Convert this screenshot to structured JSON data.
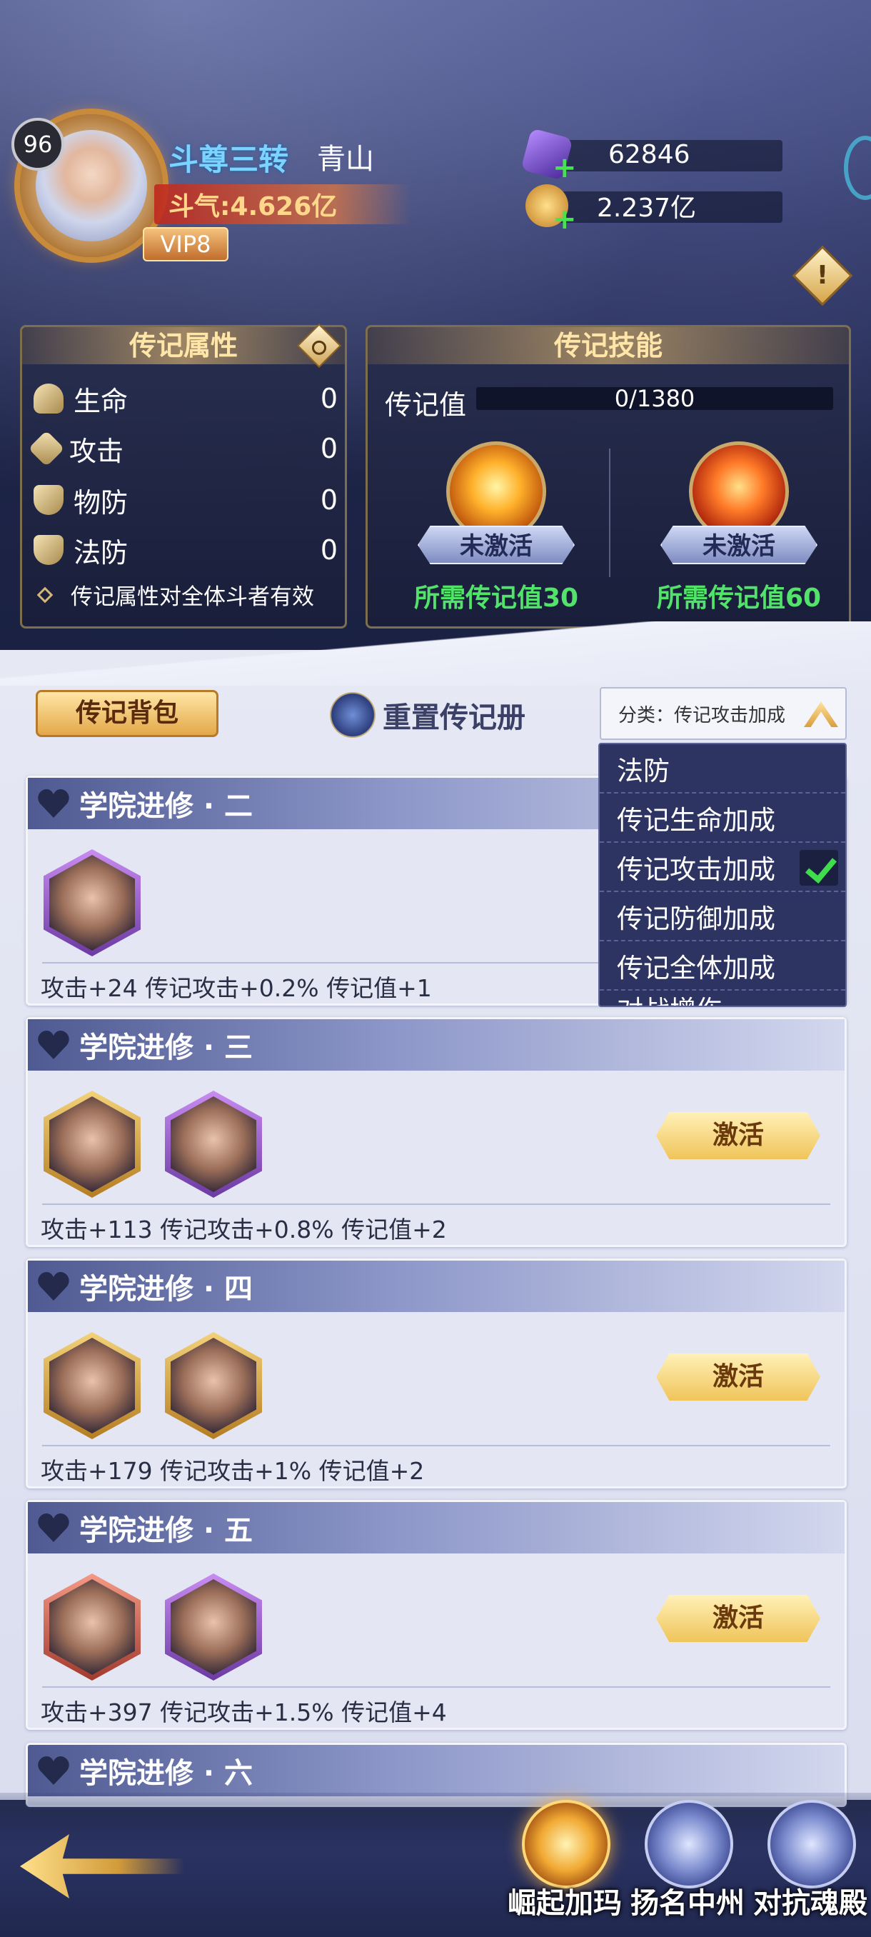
{
  "header": {
    "level": "96",
    "rank": "斗尊三转",
    "player_name": "青山",
    "power": "斗气:4.626亿",
    "vip": "VIP8",
    "gems": "62846",
    "gold": "2.237亿",
    "alert_symbol": "!"
  },
  "attributes_panel": {
    "title": "传记属性",
    "stats": [
      {
        "label": "生命",
        "value": "0",
        "icon": "heart-icon"
      },
      {
        "label": "攻击",
        "value": "0",
        "icon": "sword-icon"
      },
      {
        "label": "物防",
        "value": "0",
        "icon": "shield-icon"
      },
      {
        "label": "法防",
        "value": "0",
        "icon": "magic-shield-icon"
      }
    ],
    "note": "传记属性对全体斗者有效"
  },
  "skills_panel": {
    "title": "传记技能",
    "progress_label": "传记值",
    "progress_text": "0/1380",
    "progress_fraction": 0,
    "skills": [
      {
        "status": "未激活",
        "requirement": "所需传记值30"
      },
      {
        "status": "未激活",
        "requirement": "所需传记值60"
      }
    ]
  },
  "toolbar": {
    "bag_label": "传记背包",
    "reset_label": "重置传记册",
    "filter_label": "分类：传记攻击加成"
  },
  "dropdown": {
    "options": [
      "法防",
      "传记生命加成",
      "传记攻击加成",
      "传记防御加成",
      "传记全体加成",
      "对战增伤"
    ],
    "selected_index": 2
  },
  "cards": [
    {
      "title": "学院进修 · 二",
      "bonus": "攻击+24  传记攻击+0.2%  传记值+1",
      "portraits": [
        "purple"
      ],
      "action": ""
    },
    {
      "title": "学院进修 · 三",
      "bonus": "攻击+113  传记攻击+0.8%  传记值+2",
      "portraits": [
        "gold",
        "purple"
      ],
      "action": "激活"
    },
    {
      "title": "学院进修 · 四",
      "bonus": "攻击+179  传记攻击+1%  传记值+2",
      "portraits": [
        "gold",
        "gold"
      ],
      "action": "激活"
    },
    {
      "title": "学院进修 · 五",
      "bonus": "攻击+397  传记攻击+1.5%  传记值+4",
      "portraits": [
        "red",
        "purple"
      ],
      "action": "激活"
    },
    {
      "title": "学院进修 · 六",
      "bonus": "",
      "portraits": [],
      "action": ""
    }
  ],
  "bottom_nav": [
    {
      "label": "崛起加玛",
      "active": true
    },
    {
      "label": "扬名中州",
      "active": false
    },
    {
      "label": "对抗魂殿",
      "active": false
    }
  ],
  "colors": {
    "accent_gold": "#ffe6a8",
    "requirement_green": "#52e36a",
    "rank_blue": "#7ad4ff"
  }
}
